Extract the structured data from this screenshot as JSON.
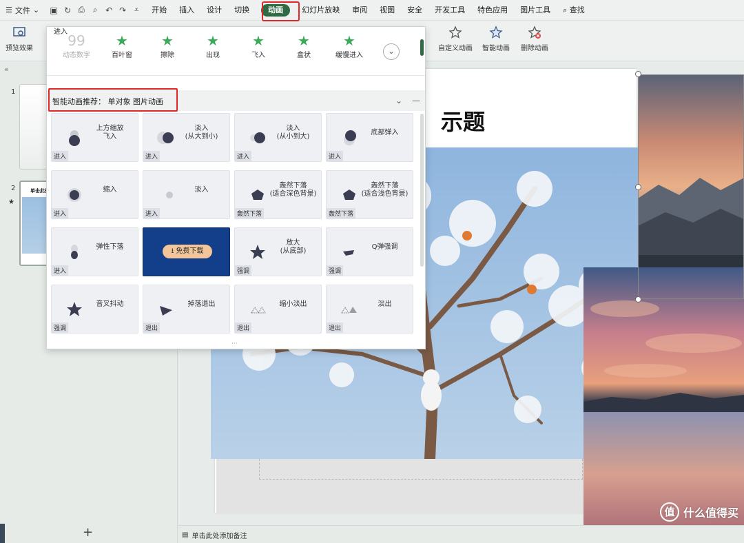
{
  "menubar": {
    "file_label": "文件",
    "tabs": [
      "开始",
      "插入",
      "设计",
      "切换",
      "动画",
      "幻灯片放映",
      "审阅",
      "视图",
      "安全",
      "开发工具",
      "特色应用",
      "图片工具"
    ],
    "search_label": "查找"
  },
  "toolbar": {
    "preview_label": "预览效果",
    "custom_anim_label": "自定义动画",
    "smart_anim_label": "智能动画",
    "delete_anim_label": "删除动画"
  },
  "gallery": {
    "group_label": "进入",
    "items": [
      "动态数字",
      "百叶窗",
      "擦除",
      "出现",
      "飞入",
      "盒状",
      "缓慢进入"
    ]
  },
  "smart": {
    "title": "智能动画推荐：  单对象 图片动画",
    "cards": [
      {
        "label": "上方缩放\n飞入",
        "tag": "进入"
      },
      {
        "label": "淡入\n(从大到小)",
        "tag": "进入"
      },
      {
        "label": "淡入\n(从小到大)",
        "tag": "进入"
      },
      {
        "label": "底部弹入",
        "tag": "进入"
      },
      {
        "label": "缩入",
        "tag": "进入"
      },
      {
        "label": "淡入",
        "tag": "进入"
      },
      {
        "label": "轰然下落\n(适合深色背景)",
        "tag": "轰然下落"
      },
      {
        "label": "轰然下落\n(适合浅色背景)",
        "tag": "轰然下落"
      },
      {
        "label": "弹性下落",
        "tag": "进入"
      },
      {
        "label": "免费下载",
        "tag": ""
      },
      {
        "label": "放大\n(从底部)",
        "tag": "强调"
      },
      {
        "label": "Q弹强调",
        "tag": "强调"
      },
      {
        "label": "音叉抖动",
        "tag": "强调"
      },
      {
        "label": "掉落退出",
        "tag": "退出"
      },
      {
        "label": "缩小淡出",
        "tag": "退出"
      },
      {
        "label": "淡出",
        "tag": "退出"
      }
    ]
  },
  "slide": {
    "title_fragment": "示题"
  },
  "thumbnails": {
    "numbers": [
      "1",
      "2"
    ],
    "slide2_title": "单击此处"
  },
  "statusbar": {
    "note_label": "单击此处添加备注",
    "add_slide": "+"
  },
  "watermark": "什么值得买",
  "colors": {
    "accent": "#2f6a45",
    "highlight_box": "#e0282a"
  }
}
